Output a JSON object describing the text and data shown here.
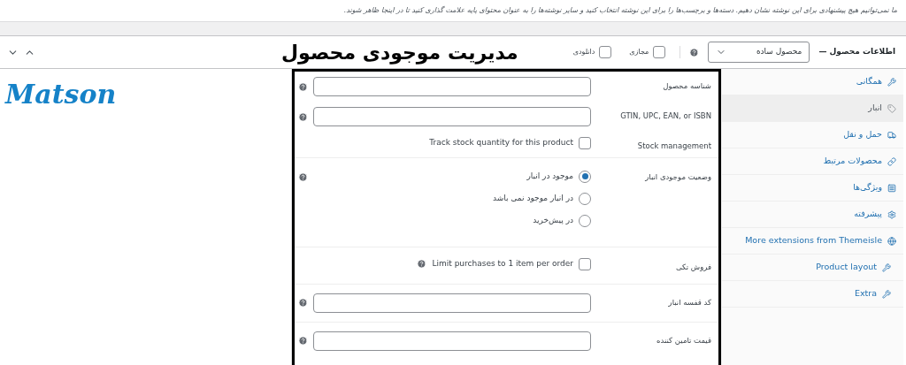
{
  "notice": "ما نمی‌توانیم هیچ پیشنهادی برای این نوشته نشان دهیم. دسته‌ها و برچسب‌ها را برای این نوشته انتخاب کنید و سایر نوشته‌ها را به عنوان محتوای پایه علامت گذاری کنید تا در اینجا ظاهر شوند.",
  "header": {
    "title": "اطلاعات محصول —",
    "product_type": "محصول ساده",
    "virtual": {
      "label": "مجازی",
      "checked": false
    },
    "downloadable": {
      "label": "دانلودی",
      "checked": false
    }
  },
  "overlay_title": "مدیریت موجودی محصول",
  "logo": "Matson",
  "tabs": [
    {
      "label": "همگانی",
      "selected": false
    },
    {
      "label": "انبار",
      "selected": true
    },
    {
      "label": "حمل و نقل",
      "selected": false
    },
    {
      "label": "محصولات مرتبط",
      "selected": false
    },
    {
      "label": "ویژگی‌ها",
      "selected": false
    },
    {
      "label": "پیشرفته",
      "selected": false
    },
    {
      "label": "More extensions from Themeisle",
      "selected": false
    },
    {
      "label": "Product layout",
      "selected": false
    },
    {
      "label": "Extra",
      "selected": false
    }
  ],
  "fields": [
    {
      "kind": "text",
      "label": "شناسه محصول",
      "help": true
    },
    {
      "kind": "text",
      "label": "GTIN, UPC, EAN, or ISBN",
      "help": true
    },
    {
      "kind": "checkbox",
      "label": "Stock management",
      "option": "Track stock quantity for this product",
      "checked": false,
      "help": false
    },
    {
      "kind": "radio",
      "label": "وضعیت موجودی انبار",
      "help": true,
      "options": [
        {
          "label": "موجود در انبار",
          "selected": true
        },
        {
          "label": "در انبار موجود نمی باشد",
          "selected": false
        },
        {
          "label": "در پیش‌خرید",
          "selected": false
        }
      ]
    },
    {
      "kind": "checkbox",
      "label": "فروش تکی",
      "option": "Limit purchases to 1 item per order",
      "checked": false,
      "help": true
    },
    {
      "kind": "text",
      "label": "کد قفسه انبار",
      "help": true
    },
    {
      "kind": "text",
      "label": "قیمت تامین کننده",
      "help": true
    }
  ]
}
